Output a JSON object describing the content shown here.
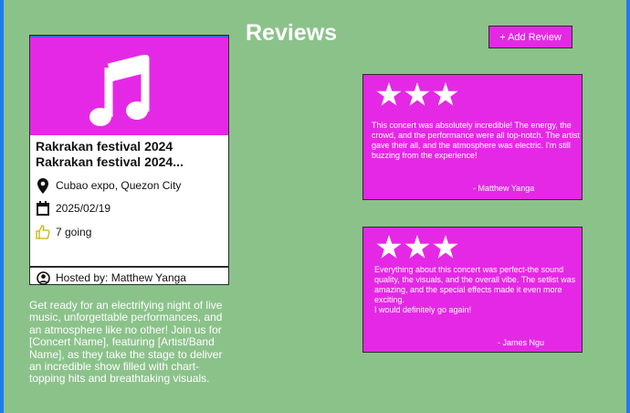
{
  "event": {
    "title_line1": "Rakrakan festival 2024",
    "title_line2": "Rakrakan festival 2024...",
    "location": "Cubao expo, Quezon City",
    "date": "2025/02/19",
    "going": "7 going",
    "host": "Hosted by: Matthew Yanga",
    "description": "Get ready for an electrifying night of live music, unforgettable performances, and an atmosphere like no other! Join us for [Concert Name], featuring [Artist/Band Name], as they take the stage to deliver an incredible show filled with chart-topping hits and breathtaking visuals."
  },
  "reviews_section": {
    "heading": "Reviews",
    "add_button_label": "+ Add Review"
  },
  "reviews": [
    {
      "rating": 3,
      "text": "This concert was absolutely incredible! The energy, the crowd, and the performance were all top-notch. The artist gave their all, and the atmosphere was electric. I'm still buzzing from the experience!",
      "author": "- Matthew Yanga"
    },
    {
      "rating": 3,
      "text": "Everything about this concert was perfect-the sound quality, the visuals, and the overall vibe. The setlist was amazing, and the special effects made it even more exciting.\nI would definitely go again!",
      "author": "- James Ngu"
    }
  ],
  "colors": {
    "background": "#8bc28a",
    "accent": "#e528e5",
    "frame": "#1f7bf0",
    "thumb_icon": "#c8b400"
  },
  "icons": {
    "banner": "music-note-icon",
    "location": "location-pin-icon",
    "date": "calendar-icon",
    "going": "thumbs-up-icon",
    "host": "user-circle-icon",
    "rating": "star-icon"
  }
}
